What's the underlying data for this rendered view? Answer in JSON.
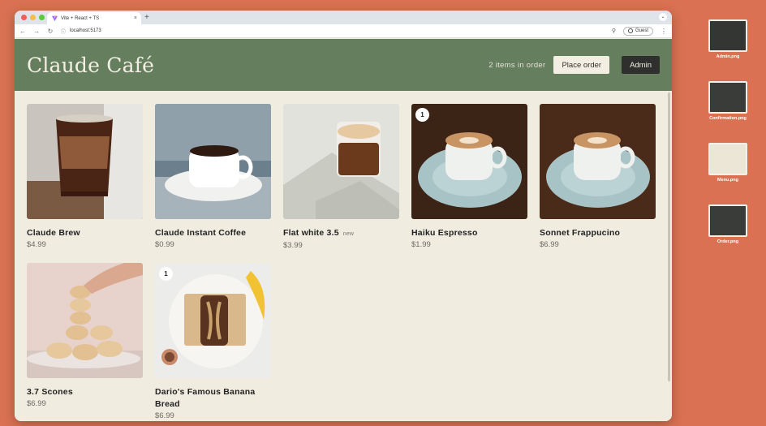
{
  "browser": {
    "tab_title": "Vite + React + TS",
    "tab_close": "×",
    "new_tab": "+",
    "url": "localhost:5173",
    "profile_label": "Guest",
    "icons": [
      "back-icon",
      "forward-icon",
      "reload-icon",
      "site-info-icon",
      "zoom-icon",
      "profile-icon",
      "menu-icon"
    ]
  },
  "header": {
    "brand": "Claude Café",
    "order_count": "2 items in order",
    "place_order_label": "Place order",
    "admin_label": "Admin"
  },
  "menu": [
    {
      "name": "Claude Brew",
      "price": "$4.99",
      "qty": "",
      "tag": ""
    },
    {
      "name": "Claude Instant Coffee",
      "price": "$0.99",
      "qty": "",
      "tag": ""
    },
    {
      "name": "Flat white 3.5",
      "price": "$3.99",
      "qty": "",
      "tag": "new"
    },
    {
      "name": "Haiku Espresso",
      "price": "$1.99",
      "qty": "1",
      "tag": ""
    },
    {
      "name": "Sonnet Frappucino",
      "price": "$6.99",
      "qty": "",
      "tag": ""
    },
    {
      "name": "3.7 Scones",
      "price": "$6.99",
      "qty": "",
      "tag": ""
    },
    {
      "name": "Dario's Famous Banana Bread",
      "price": "$6.99",
      "qty": "1",
      "tag": ""
    }
  ],
  "desktop_files": [
    {
      "label": "Admin.png"
    },
    {
      "label": "Confirmation.png"
    },
    {
      "label": "Menu.png"
    },
    {
      "label": "Order.png"
    }
  ],
  "colors": {
    "desktop_bg": "#d97152",
    "header_green": "#647e5e",
    "page_bg": "#f0ece0",
    "admin_button": "#2f302d"
  }
}
